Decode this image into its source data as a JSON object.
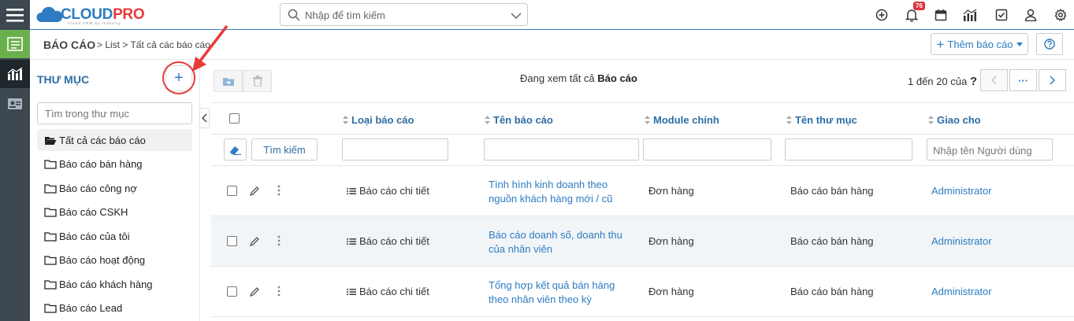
{
  "app": {
    "logo_text_cloud": "CLOUD",
    "logo_text_pro": "PRO",
    "logo_tagline": "Cloud CRM by Industry",
    "search_placeholder": "Nhập để tìm kiếm",
    "notification_count": "76"
  },
  "header": {
    "title": "BÁO CÁO",
    "breadcrumb": "> List > Tất cả các báo cáo",
    "add_report_label": "Thêm báo cáo"
  },
  "sidebar": {
    "title": "THƯ MỤC",
    "add_label": "+",
    "search_placeholder": "Tìm trong thư mục",
    "folders": [
      {
        "label": "Tất cả các báo cáo",
        "active": true
      },
      {
        "label": "Báo cáo bán hàng"
      },
      {
        "label": "Báo cáo công nợ"
      },
      {
        "label": "Báo cáo CSKH"
      },
      {
        "label": "Báo cáo của tôi"
      },
      {
        "label": "Báo cáo hoạt động"
      },
      {
        "label": "Báo cáo khách hàng"
      },
      {
        "label": "Báo cáo Lead"
      }
    ]
  },
  "list": {
    "viewing_prefix": "Đang xem tất cả",
    "viewing_module": "Báo cáo",
    "pager_text": "1 đến 20 của",
    "pager_help": "?",
    "more_label": "···",
    "columns": [
      "Loại báo cáo",
      "Tên báo cáo",
      "Module chính",
      "Tên thư mục",
      "Giao cho"
    ],
    "search_button": "Tìm kiếm",
    "assignee_placeholder": "Nhập tên Người dùng",
    "rows": [
      {
        "type": "Báo cáo chi tiết",
        "name_line1": "Tình hình kinh doanh theo",
        "name_line2": "nguồn khách hàng mới / cũ",
        "module": "Đơn hàng",
        "folder": "Báo cáo bán hàng",
        "assignee": "Administrator"
      },
      {
        "type": "Báo cáo chi tiết",
        "name_line1": "Báo cáo doanh số, doanh thu",
        "name_line2": "của nhân viên",
        "module": "Đơn hàng",
        "folder": "Báo cáo bán hàng",
        "assignee": "Administrator"
      },
      {
        "type": "Báo cáo chi tiết",
        "name_line1": "Tổng hợp kết quả bán hàng",
        "name_line2": "theo nhân viên theo kỳ",
        "module": "Đơn hàng",
        "folder": "Báo cáo bán hàng",
        "assignee": "Administrator"
      }
    ]
  },
  "colors": {
    "rail": "#3d4750",
    "rail_active": "#6ab04c",
    "primary": "#2d7cc1",
    "heading": "#2d6ea6",
    "annotation": "#e63b3b",
    "badge": "#d9363e"
  }
}
